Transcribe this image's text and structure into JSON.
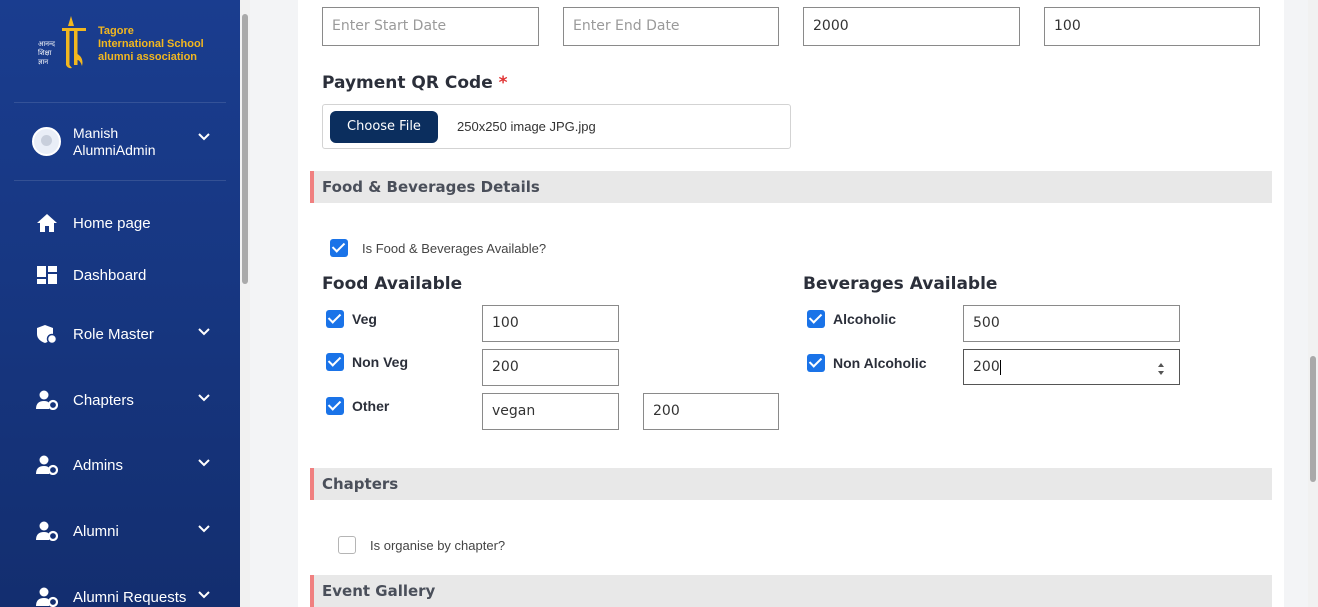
{
  "logo": {
    "line1": "Tagore",
    "line2": "International School",
    "line3": "alumni association"
  },
  "user": {
    "first_name": "Manish",
    "last_name": "AlumniAdmin"
  },
  "nav": [
    {
      "label": "Home page",
      "icon": "home-icon"
    },
    {
      "label": "Dashboard",
      "icon": "dashboard-icon"
    },
    {
      "label": "Role Master",
      "icon": "role-shield-icon"
    },
    {
      "label": "Chapters",
      "icon": "user-gear-icon"
    },
    {
      "label": "Admins",
      "icon": "user-gear-icon"
    },
    {
      "label": "Alumni",
      "icon": "user-gear-icon"
    },
    {
      "label": "Alumni Requests",
      "icon": "user-gear-icon"
    }
  ],
  "dates": {
    "start_placeholder": "Enter Start Date",
    "end_placeholder": "Enter End Date",
    "price_value": "2000",
    "capacity_value": "100"
  },
  "payment": {
    "label": "Payment QR Code",
    "required_mark": "*",
    "choose_button": "Choose File",
    "file_name": "250x250 image JPG.jpg"
  },
  "food_section": {
    "title": "Food & Beverages Details",
    "available_label": "Is Food & Beverages Available?",
    "available_checked": true,
    "food_title": "Food Available",
    "beverages_title": "Beverages Available",
    "food_items": [
      {
        "label": "Veg",
        "checked": true,
        "value": "100"
      },
      {
        "label": "Non Veg",
        "checked": true,
        "value": "200"
      },
      {
        "label": "Other",
        "checked": true,
        "name_value": "vegan",
        "value": "200"
      }
    ],
    "beverage_items": [
      {
        "label": "Alcoholic",
        "checked": true,
        "value": "500"
      },
      {
        "label": "Non Alcoholic",
        "checked": true,
        "value": "200"
      }
    ]
  },
  "chapters_section": {
    "title": "Chapters",
    "organise_label": "Is organise by chapter?",
    "organise_checked": false
  },
  "gallery_section": {
    "title": "Event Gallery"
  },
  "colors": {
    "sidebar": "#173782",
    "accent": "#1a73e8",
    "section_border": "#f08080",
    "file_button": "#0b2e5e",
    "logo": "#f2b71f"
  }
}
